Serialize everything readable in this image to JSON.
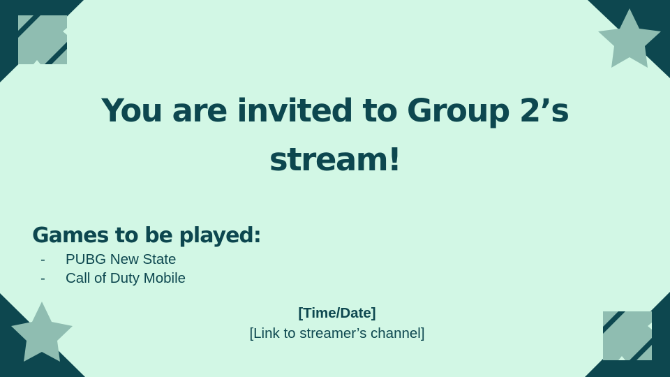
{
  "colors": {
    "background": "#d2f7e5",
    "primary": "#0d474f",
    "accent": "#8fbdb1"
  },
  "slide": {
    "title_line1": "You are invited to Group 2’s",
    "title_line2": "stream!",
    "games_heading": "Games to be played:",
    "games": [
      {
        "bullet": "-",
        "name": "PUBG New State"
      },
      {
        "bullet": "-",
        "name": "Call of Duty Mobile"
      }
    ],
    "time_date": "[Time/Date]",
    "link": "[Link to streamer’s channel]"
  },
  "decorations": {
    "top_left": "star-cross-icon",
    "top_right": "eight-point-star-icon",
    "bottom_left": "eight-point-star-icon",
    "bottom_right": "star-cross-icon"
  }
}
